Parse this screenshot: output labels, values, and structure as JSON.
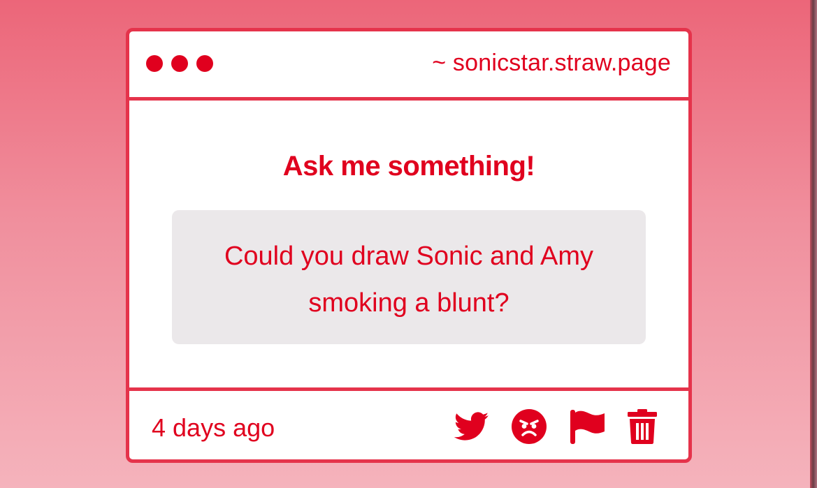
{
  "window": {
    "domain": "~ sonicstar.straw.page"
  },
  "main": {
    "heading": "Ask me something!",
    "question": "Could you draw Sonic and Amy smoking a blunt?"
  },
  "footer": {
    "timestamp": "4 days ago",
    "actions": [
      "twitter-icon",
      "angry-face-icon",
      "flag-icon",
      "trash-icon"
    ]
  },
  "colors": {
    "accent": "#e0001e",
    "border": "#e5334b",
    "question_background": "#ebe8ea"
  }
}
